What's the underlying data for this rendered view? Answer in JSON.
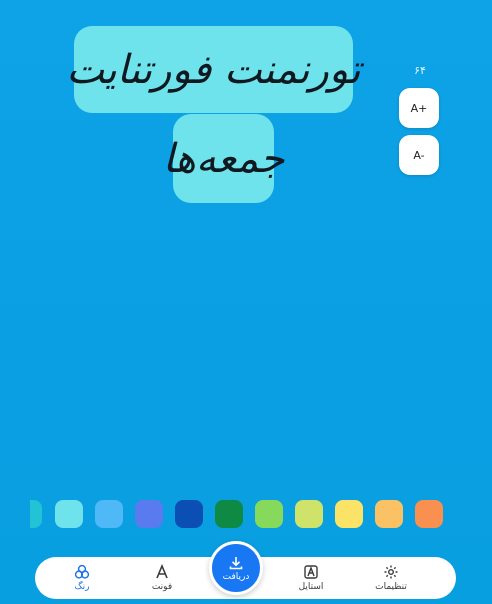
{
  "canvas": {
    "lines": [
      "تورنمنت فورتنایت",
      "جمعه‌ها"
    ],
    "font_size": "۶۴",
    "increase_label": "A+",
    "decrease_label": "A-",
    "block_color": "#6fe3ec"
  },
  "palette": [
    "#21c3d4",
    "#6fe3ec",
    "#4fb8f7",
    "#5a7bf0",
    "#0c4fb4",
    "#0f8a44",
    "#86d95a",
    "#cfe36b",
    "#fbe368",
    "#fbc165",
    "#f9904f"
  ],
  "nav": {
    "color": {
      "label": "رنگ",
      "icon": "color-circles-icon"
    },
    "font": {
      "label": "فونت",
      "icon": "font-a-icon"
    },
    "download": {
      "label": "دریافت",
      "icon": "download-icon"
    },
    "style": {
      "label": "استایل",
      "icon": "style-icon"
    },
    "settings": {
      "label": "تنظیمات",
      "icon": "gear-icon"
    }
  },
  "colors": {
    "accent": "#1877f2",
    "background": "#0ea2e6"
  }
}
